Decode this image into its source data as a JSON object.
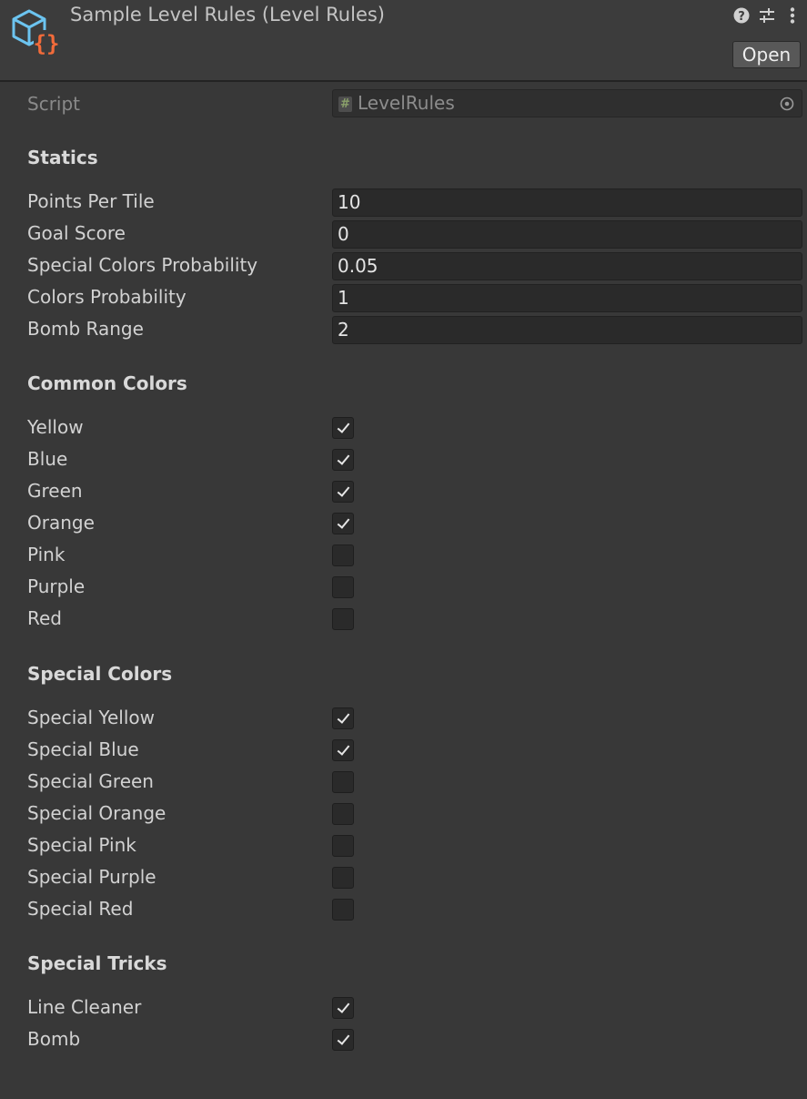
{
  "header": {
    "title": "Sample Level Rules (Level Rules)",
    "open_label": "Open"
  },
  "script": {
    "label": "Script",
    "value": "LevelRules"
  },
  "statics": {
    "title": "Statics",
    "fields": [
      {
        "label": "Points Per Tile",
        "value": "10"
      },
      {
        "label": "Goal Score",
        "value": "0"
      },
      {
        "label": "Special Colors Probability",
        "value": "0.05"
      },
      {
        "label": "Colors Probability",
        "value": "1"
      },
      {
        "label": "Bomb Range",
        "value": "2"
      }
    ]
  },
  "common_colors": {
    "title": "Common Colors",
    "items": [
      {
        "label": "Yellow",
        "checked": true
      },
      {
        "label": "Blue",
        "checked": true
      },
      {
        "label": "Green",
        "checked": true
      },
      {
        "label": "Orange",
        "checked": true
      },
      {
        "label": "Pink",
        "checked": false
      },
      {
        "label": "Purple",
        "checked": false
      },
      {
        "label": "Red",
        "checked": false
      }
    ]
  },
  "special_colors": {
    "title": "Special Colors",
    "items": [
      {
        "label": "Special Yellow",
        "checked": true
      },
      {
        "label": "Special Blue",
        "checked": true
      },
      {
        "label": "Special Green",
        "checked": false
      },
      {
        "label": "Special Orange",
        "checked": false
      },
      {
        "label": "Special Pink",
        "checked": false
      },
      {
        "label": "Special Purple",
        "checked": false
      },
      {
        "label": "Special Red",
        "checked": false
      }
    ]
  },
  "special_tricks": {
    "title": "Special Tricks",
    "items": [
      {
        "label": "Line Cleaner",
        "checked": true
      },
      {
        "label": "Bomb",
        "checked": true
      }
    ]
  },
  "icons": {
    "asset": "scriptable-object-icon",
    "help": "help-icon",
    "presets": "presets-sliders-icon",
    "menu": "kebab-menu-icon",
    "picker": "object-picker-icon"
  },
  "colors": {
    "background": "#383838",
    "header": "#3c3c3c",
    "field": "#2a2a2a",
    "accent_blue": "#6cc4f0",
    "accent_orange": "#f26b3a"
  }
}
